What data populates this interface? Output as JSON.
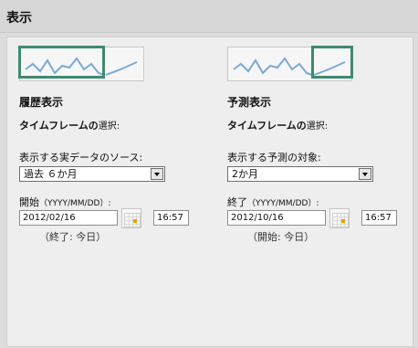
{
  "header": {
    "title": "表示"
  },
  "history": {
    "title": "履歴表示",
    "timeframe_label": "タイムフレームの",
    "timeframe_suffix": "選択:",
    "source_label": "表示する実データのソース:",
    "source_value": "過去 ６か月",
    "datetime_label_main": "開始",
    "datetime_label_format": "（YYYY/MM/DD）:",
    "date_value": "2012/02/16",
    "time_value": "16:57",
    "note": "（終了: 今日）"
  },
  "forecast": {
    "title": "予測表示",
    "timeframe_label": "タイムフレームの",
    "timeframe_suffix": "選択:",
    "target_label": "表示する予測の対象:",
    "target_value": "2か月",
    "datetime_label_main": "終了",
    "datetime_label_format": "（YYYY/MM/DD）:",
    "date_value": "2012/10/16",
    "time_value": "16:57",
    "note": "（開始: 今日）"
  },
  "colors": {
    "highlight": "#3e8a6f",
    "line": "#7aa9d6"
  }
}
